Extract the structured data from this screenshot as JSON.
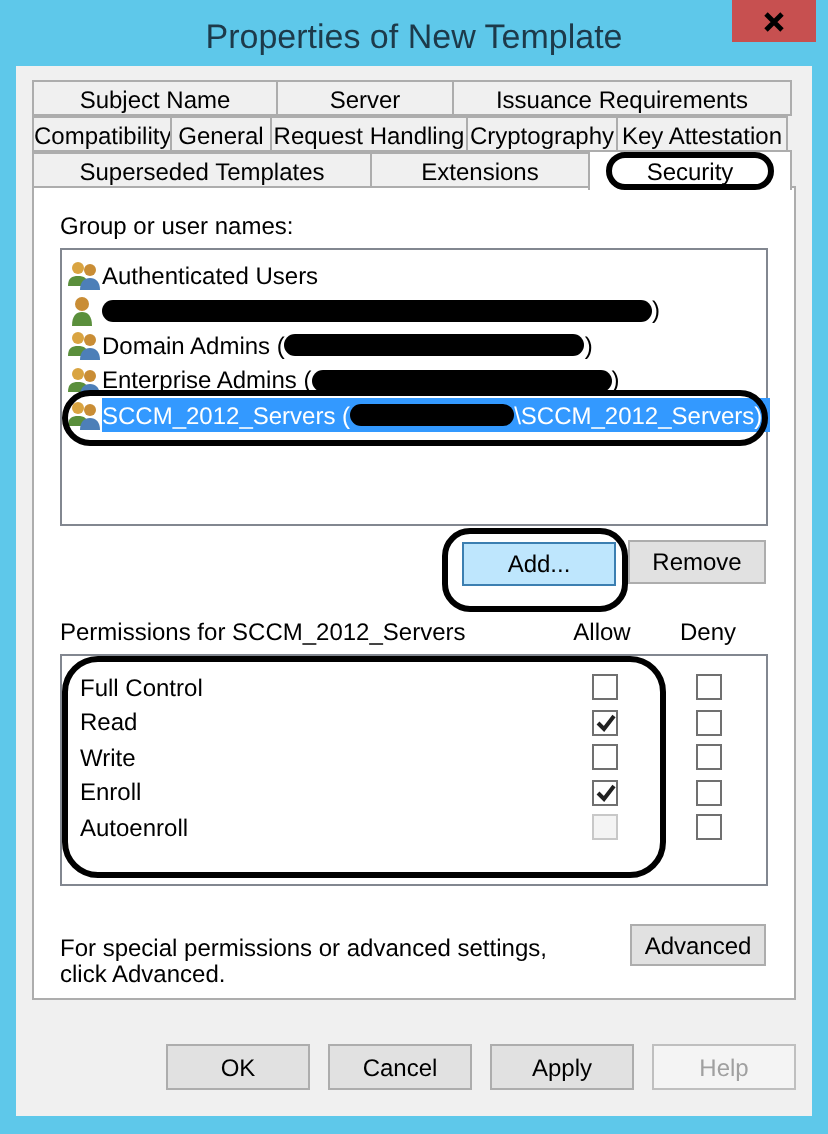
{
  "window": {
    "title": "Properties of New Template"
  },
  "tab_rows": [
    [
      {
        "label": "Subject Name",
        "selected": false
      },
      {
        "label": "Server",
        "selected": false
      },
      {
        "label": "Issuance Requirements",
        "selected": false
      }
    ],
    [
      {
        "label": "Compatibility",
        "selected": false
      },
      {
        "label": "General",
        "selected": false
      },
      {
        "label": "Request Handling",
        "selected": false
      },
      {
        "label": "Cryptography",
        "selected": false
      },
      {
        "label": "Key Attestation",
        "selected": false
      }
    ],
    [
      {
        "label": "Superseded Templates",
        "selected": false
      },
      {
        "label": "Extensions",
        "selected": false
      },
      {
        "label": "Security",
        "selected": true,
        "circled": true
      }
    ]
  ],
  "group_label": "Group or user names:",
  "users": [
    {
      "name": "Authenticated Users",
      "kind": "group",
      "redacted": false,
      "selected": false
    },
    {
      "kind": "user",
      "redacted": true,
      "name_end": ")",
      "selected": false
    },
    {
      "name": "Domain Admins (",
      "kind": "group",
      "redacted": true,
      "name_end": ")",
      "selected": false
    },
    {
      "name": "Enterprise Admins (",
      "kind": "group",
      "redacted": true,
      "name_end": ")",
      "selected": false
    },
    {
      "name": "SCCM_2012_Servers (",
      "kind": "group",
      "redacted": true,
      "name_end": "\\SCCM_2012_Servers)",
      "selected": true,
      "circled": true
    }
  ],
  "add_button": {
    "label": "Add...",
    "circled": true
  },
  "remove_button": {
    "label": "Remove"
  },
  "permissions_label": "Permissions for SCCM_2012_Servers",
  "columns": [
    "Allow",
    "Deny"
  ],
  "permissions_circled": true,
  "permissions": [
    {
      "name": "Full Control",
      "allow": {
        "checked": false,
        "disabled": false
      },
      "deny": {
        "checked": false
      }
    },
    {
      "name": "Read",
      "allow": {
        "checked": true,
        "disabled": false
      },
      "deny": {
        "checked": false
      }
    },
    {
      "name": "Write",
      "allow": {
        "checked": false,
        "disabled": false
      },
      "deny": {
        "checked": false
      }
    },
    {
      "name": "Enroll",
      "allow": {
        "checked": true,
        "disabled": false
      },
      "deny": {
        "checked": false
      }
    },
    {
      "name": "Autoenroll",
      "allow": {
        "checked": false,
        "disabled": true
      },
      "deny": {
        "checked": false
      }
    }
  ],
  "advanced_note": "For special permissions or advanced settings, click Advanced.",
  "advanced_button": {
    "label": "Advanced"
  },
  "footer_buttons": [
    {
      "label": "OK",
      "disabled": false
    },
    {
      "label": "Cancel",
      "disabled": false
    },
    {
      "label": "Apply",
      "disabled": false
    },
    {
      "label": "Help",
      "disabled": true
    }
  ]
}
